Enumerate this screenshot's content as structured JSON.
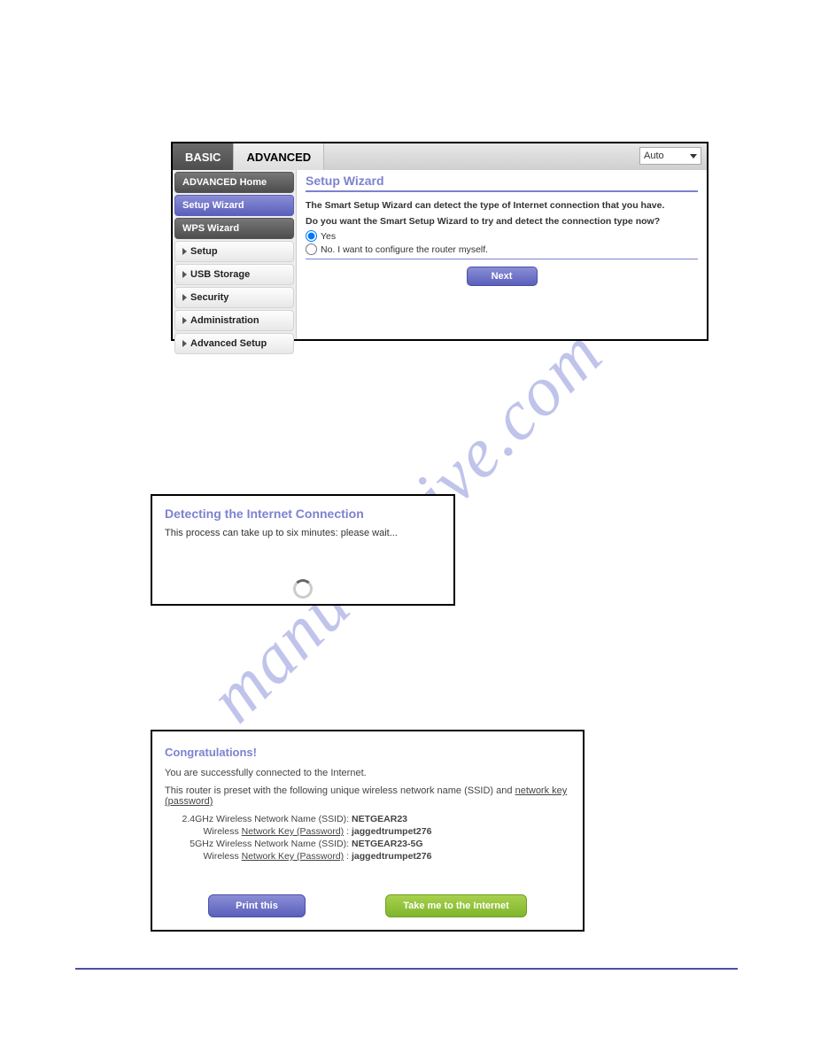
{
  "watermark": "manualshive.com",
  "panel1": {
    "tabs": {
      "basic": "BASIC",
      "advanced": "ADVANCED"
    },
    "dropdown": "Auto",
    "sidebar": {
      "advanced_home": "ADVANCED Home",
      "setup_wizard": "Setup Wizard",
      "wps_wizard": "WPS Wizard",
      "setup": "Setup",
      "usb_storage": "USB Storage",
      "security": "Security",
      "administration": "Administration",
      "advanced_setup": "Advanced Setup"
    },
    "main": {
      "title": "Setup Wizard",
      "desc1": "The Smart Setup Wizard can detect the type of Internet connection that you have.",
      "desc2": "Do you want the Smart Setup Wizard to try and detect the connection type now?",
      "opt_yes": "Yes",
      "opt_no": "No. I want to configure the router myself.",
      "next": "Next"
    }
  },
  "panel2": {
    "title": "Detecting the Internet Connection",
    "msg": "This process can take up to six minutes: please wait..."
  },
  "panel3": {
    "title": "Congratulations!",
    "line1": "You are successfully connected to the Internet.",
    "line2a": "This router is preset with the following unique wireless network name (SSID) and ",
    "line2_link": "network key (password)",
    "net": {
      "l1": "2.4GHz Wireless Network Name (SSID):",
      "v1": "NETGEAR23",
      "l2a": "Wireless ",
      "l2_link": "Network Key (Password)",
      "l2b": " :",
      "v2": "jaggedtrumpet276",
      "l3": "5GHz Wireless Network Name (SSID):",
      "v3": "NETGEAR23-5G",
      "l4a": "Wireless ",
      "l4_link": "Network Key (Password)",
      "l4b": " :",
      "v4": "jaggedtrumpet276"
    },
    "btn_print": "Print this",
    "btn_go": "Take me to the Internet"
  }
}
